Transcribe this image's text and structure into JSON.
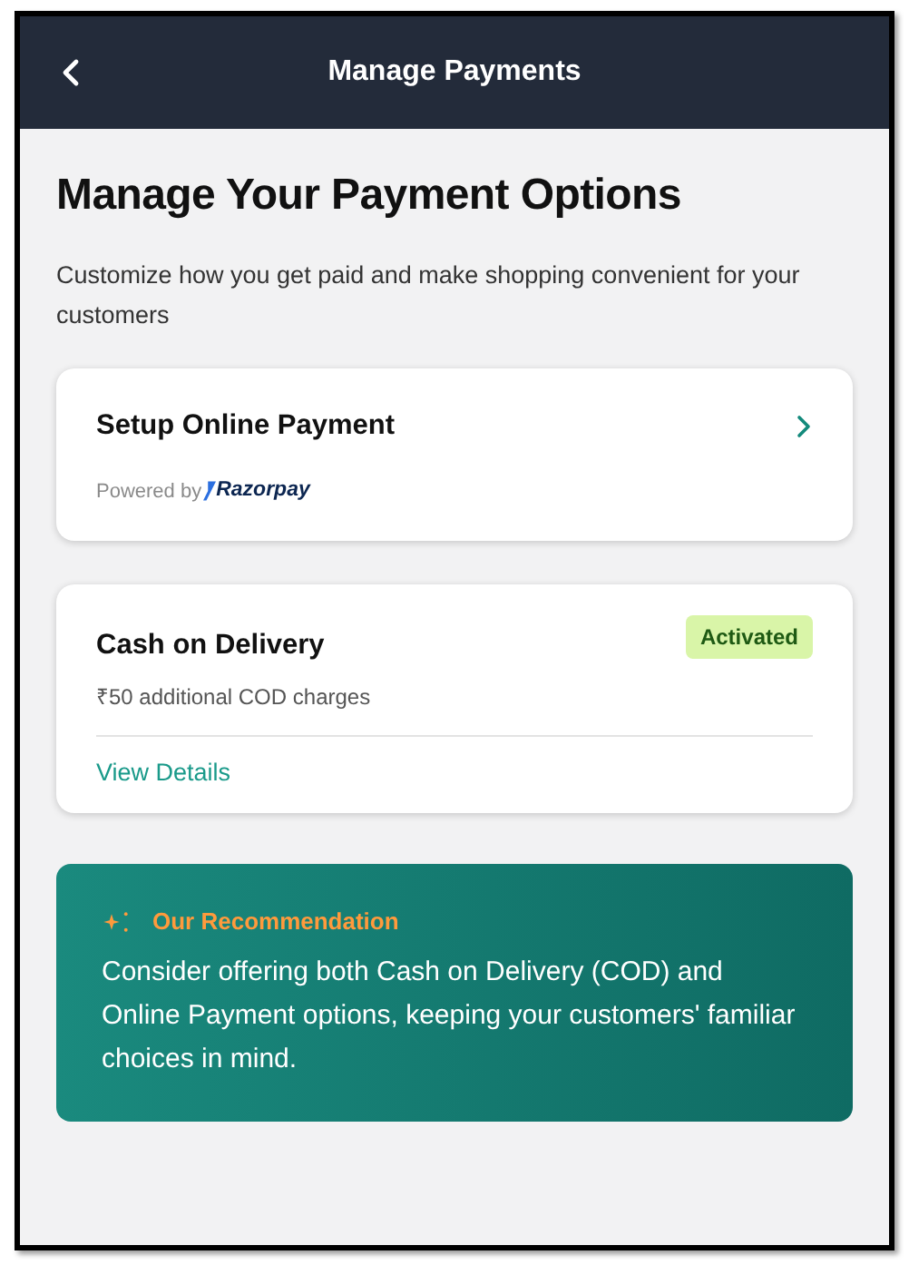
{
  "header": {
    "title": "Manage Payments"
  },
  "heading": "Manage Your Payment Options",
  "subtitle": "Customize how you get paid and make shopping convenient for your customers",
  "online_payment": {
    "title": "Setup Online Payment",
    "powered_by": "Powered by",
    "brand": "Razorpay"
  },
  "cod": {
    "title": "Cash on Delivery",
    "badge": "Activated",
    "note": "₹50 additional COD charges",
    "link": "View Details"
  },
  "recommendation": {
    "title": "Our Recommendation",
    "text": "Consider offering both Cash on Delivery (COD) and Online Payment options, keeping your customers' familiar choices in mind."
  }
}
